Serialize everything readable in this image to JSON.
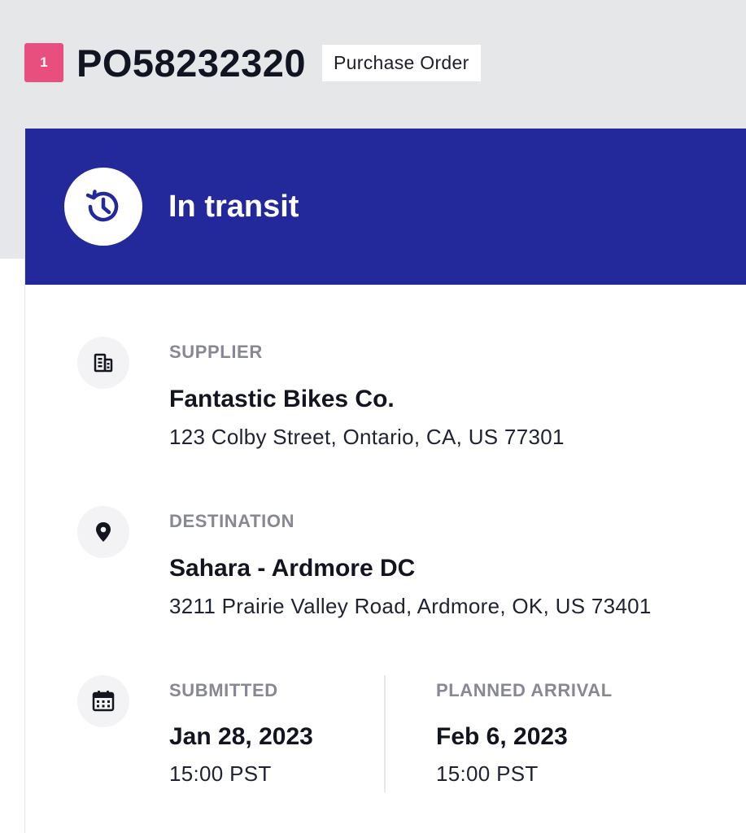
{
  "header": {
    "badge": "1",
    "po_number": "PO58232320",
    "type_label": "Purchase Order"
  },
  "status": {
    "text": "In transit",
    "icon": "history-clock-icon",
    "color": "#23299b"
  },
  "supplier": {
    "label": "SUPPLIER",
    "name": "Fantastic Bikes Co.",
    "address": "123 Colby Street, Ontario, CA, US 77301",
    "icon": "building-icon"
  },
  "destination": {
    "label": "DESTINATION",
    "name": "Sahara - Ardmore DC",
    "address": "3211 Prairie Valley Road, Ardmore, OK, US 73401",
    "icon": "location-pin-icon"
  },
  "dates": {
    "icon": "calendar-icon",
    "submitted": {
      "label": "SUBMITTED",
      "date": "Jan 28, 2023",
      "time": "15:00 PST"
    },
    "planned_arrival": {
      "label": "PLANNED ARRIVAL",
      "date": "Feb 6, 2023",
      "time": "15:00 PST"
    }
  },
  "colors": {
    "badge": "#e84f7f",
    "label_gray": "#868893"
  }
}
